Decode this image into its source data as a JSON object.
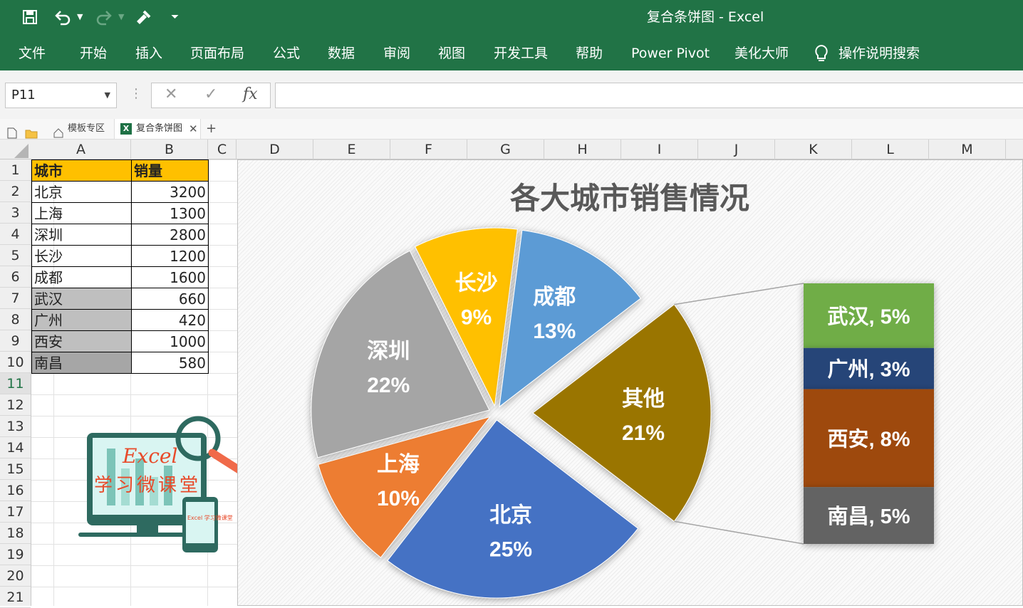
{
  "window_title": "复合条饼图  -  Excel",
  "quick_access": {
    "save_icon": "save-icon",
    "undo_icon": "undo-icon",
    "redo_icon": "redo-icon",
    "format_painter_icon": "format-painter-icon",
    "customize_icon": "customize-icon"
  },
  "menu": [
    "文件",
    "开始",
    "插入",
    "页面布局",
    "公式",
    "数据",
    "审阅",
    "视图",
    "开发工具",
    "帮助",
    "Power Pivot",
    "美化大师"
  ],
  "tell_me": "操作说明搜索",
  "formula_bar": {
    "name_box": "P11",
    "cancel": "✕",
    "enter": "✓",
    "fx": "fx",
    "value": ""
  },
  "tabs": {
    "template_zone": "模板专区",
    "workbook": "复合条饼图",
    "add": "+"
  },
  "columns": [
    "A",
    "B",
    "C",
    "D",
    "E",
    "F",
    "G",
    "H",
    "I",
    "J",
    "K",
    "L",
    "M"
  ],
  "rows": [
    "1",
    "2",
    "3",
    "4",
    "5",
    "6",
    "7",
    "8",
    "9",
    "10",
    "11",
    "12",
    "13",
    "14",
    "15",
    "16",
    "17",
    "18",
    "19",
    "20",
    "21"
  ],
  "selected_row": "11",
  "table": {
    "headers": [
      "城市",
      "销量"
    ],
    "rows": [
      [
        "北京",
        "3200"
      ],
      [
        "上海",
        "1300"
      ],
      [
        "深圳",
        "2800"
      ],
      [
        "长沙",
        "1200"
      ],
      [
        "成都",
        "1600"
      ],
      [
        "武汉",
        "660"
      ],
      [
        "广州",
        "420"
      ],
      [
        "西安",
        "1000"
      ],
      [
        "南昌",
        "580"
      ]
    ]
  },
  "logo": {
    "title": "Excel",
    "subtitle": "学习微课堂",
    "small": "Excel 学习微课堂"
  },
  "chart_data": {
    "type": "pie",
    "title": "各大城市销售情况",
    "pie_slices": [
      {
        "label": "北京",
        "percent": "25%",
        "value": 3200,
        "color": "#4472c4"
      },
      {
        "label": "上海",
        "percent": "10%",
        "value": 1300,
        "color": "#ed7d31"
      },
      {
        "label": "深圳",
        "percent": "22%",
        "value": 2800,
        "color": "#a5a5a5"
      },
      {
        "label": "长沙",
        "percent": "9%",
        "value": 1200,
        "color": "#ffc000"
      },
      {
        "label": "成都",
        "percent": "13%",
        "value": 1600,
        "color": "#5b9bd5"
      },
      {
        "label": "其他",
        "percent": "21%",
        "value": 2660,
        "color": "#9a7500"
      }
    ],
    "bar_segments": [
      {
        "label": "武汉, 5%",
        "value": 660,
        "color": "#70ad47"
      },
      {
        "label": "广州, 3%",
        "value": 420,
        "color": "#264478"
      },
      {
        "label": "西安, 8%",
        "value": 1000,
        "color": "#9e480e"
      },
      {
        "label": "南昌, 5%",
        "value": 580,
        "color": "#636363"
      }
    ]
  }
}
